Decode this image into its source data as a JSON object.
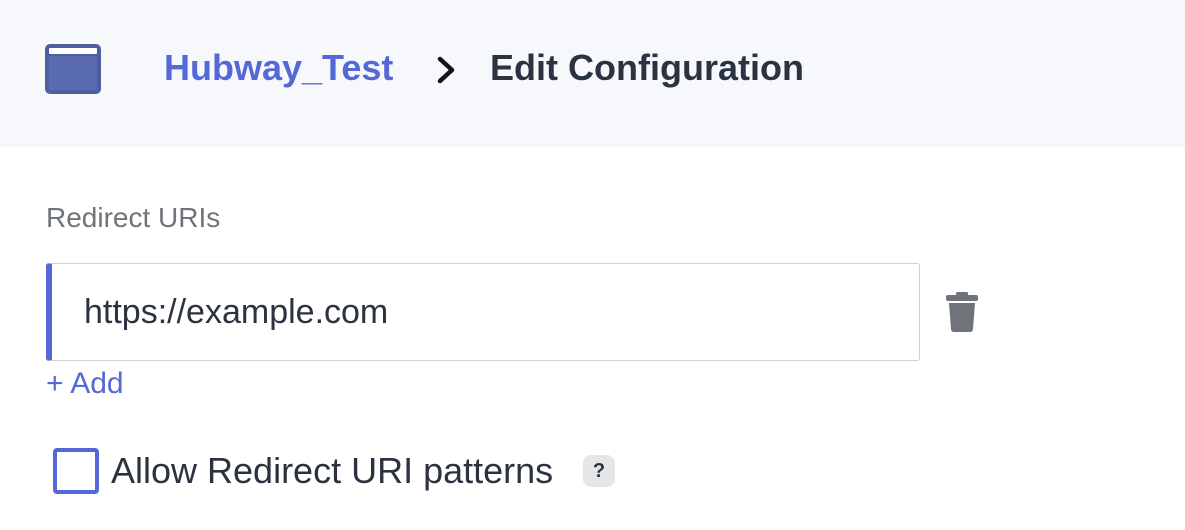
{
  "header": {
    "app_icon": "window-icon",
    "breadcrumb": {
      "parent": "Hubway_Test",
      "separator_icon": "chevron-right-icon",
      "current": "Edit Configuration"
    }
  },
  "form": {
    "redirect_uris": {
      "label": "Redirect URIs",
      "values": [
        "https://example.com"
      ],
      "delete_icon": "trash-icon",
      "add_label": "+ Add"
    },
    "allow_patterns": {
      "label": "Allow Redirect URI patterns",
      "checked": false,
      "help_label": "?"
    }
  },
  "colors": {
    "accent": "#5468d8",
    "header_bg": "#f7f8fc",
    "text_primary": "#2c3340",
    "text_muted": "#6f747b",
    "icon_gray": "#6f747b"
  }
}
